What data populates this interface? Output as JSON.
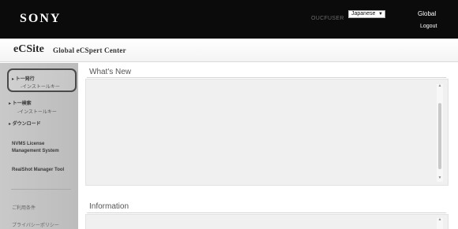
{
  "header": {
    "brand": "SONY",
    "user_id": "OUCFUSER",
    "language": "Japanese",
    "global_label": "Global",
    "logout_label": "Logout"
  },
  "title": {
    "name": "eCSite",
    "subtitle": "Global eCSpert Center"
  },
  "sidebar": {
    "items": [
      {
        "label": "▸ ト一発行"
      },
      {
        "label": "-インストールキー"
      },
      {
        "label": "▸ ト一検索"
      },
      {
        "label": "-インストールキー"
      },
      {
        "label": "▸ ダウンロード"
      },
      {
        "label": "NVMS License"
      },
      {
        "label": "Management System"
      },
      {
        "label": "RealShot Manager Tool"
      },
      {
        "label": "ご利用条件"
      },
      {
        "label": "プライバシーポリシー"
      }
    ]
  },
  "main": {
    "whats_new": "What's New",
    "information": "Information"
  }
}
